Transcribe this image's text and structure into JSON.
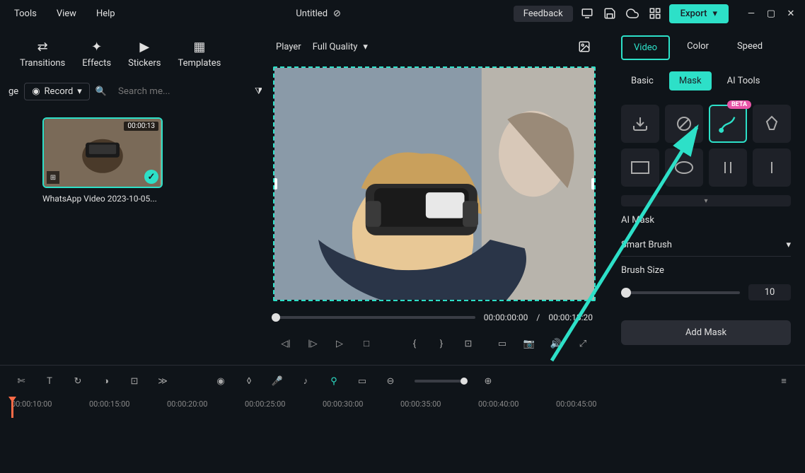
{
  "menu": {
    "tools": "Tools",
    "view": "View",
    "help": "Help"
  },
  "title": "Untitled",
  "feedback": "Feedback",
  "export": "Export",
  "tabs": {
    "transitions": "Transitions",
    "effects": "Effects",
    "stickers": "Stickers",
    "templates": "Templates"
  },
  "left": {
    "ge_label": "ge",
    "record": "Record",
    "search_ph": "Search me..."
  },
  "media": {
    "duration": "00:00:13",
    "name": "WhatsApp Video 2023-10-05..."
  },
  "player": {
    "label": "Player",
    "quality": "Full Quality",
    "current": "00:00:00:00",
    "sep": "/",
    "total": "00:00:18:20"
  },
  "props": {
    "video": "Video",
    "color": "Color",
    "speed": "Speed"
  },
  "subs": {
    "basic": "Basic",
    "mask": "Mask",
    "ai": "AI Tools"
  },
  "beta": "BETA",
  "ai_mask": "AI Mask",
  "smart_brush": "Smart Brush",
  "brush_size_label": "Brush Size",
  "brush_size_value": "10",
  "add_mask": "Add Mask",
  "ruler": [
    "00:00:10:00",
    "00:00:15:00",
    "00:00:20:00",
    "00:00:25:00",
    "00:00:30:00",
    "00:00:35:00",
    "00:00:40:00",
    "00:00:45:00"
  ]
}
